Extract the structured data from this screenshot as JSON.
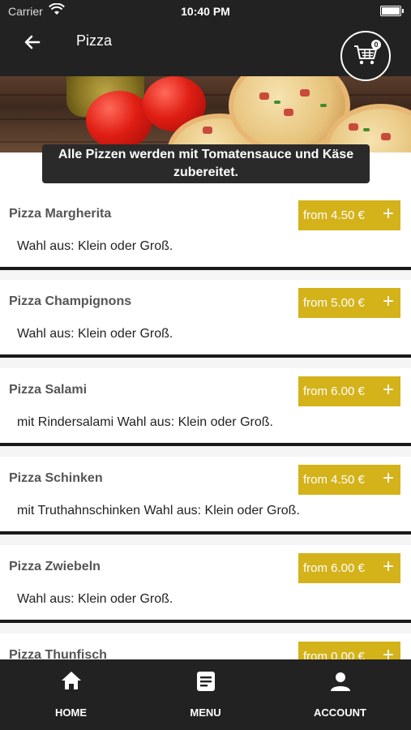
{
  "status_bar": {
    "carrier": "Carrier",
    "time": "10:40 PM"
  },
  "header": {
    "title": "Pizza",
    "back_icon": "arrow-left-icon"
  },
  "cart": {
    "count": "0",
    "icon": "shopping-cart-icon"
  },
  "notice": {
    "text": "Alle Pizzen werden mit Tomatensauce und Käse zubereitet."
  },
  "accent_color": "#d4b21a",
  "items": [
    {
      "name": "Pizza Margherita",
      "price": "from 4.50 €",
      "plus": "+",
      "description": "Wahl aus: Klein oder Groß."
    },
    {
      "name": "Pizza Champignons",
      "price": "from 5.00 €",
      "plus": "+",
      "description": "Wahl aus: Klein oder Groß."
    },
    {
      "name": "Pizza Salami",
      "price": "from 6.00 €",
      "plus": "+",
      "description": "mit Rindersalami  Wahl aus: Klein oder Groß."
    },
    {
      "name": "Pizza Schinken",
      "price": "from 4.50 €",
      "plus": "+",
      "description": "mit Truthahnschinken  Wahl aus: Klein oder Groß."
    },
    {
      "name": "Pizza Zwiebeln",
      "price": "from 6.00 €",
      "plus": "+",
      "description": "Wahl aus: Klein oder Groß."
    },
    {
      "name": "Pizza Thunfisch",
      "price": "from 0.00 €",
      "plus": "+",
      "description": ""
    }
  ],
  "tabs": [
    {
      "label": "HOME",
      "icon": "home-icon"
    },
    {
      "label": "MENU",
      "icon": "menu-icon"
    },
    {
      "label": "ACCOUNT",
      "icon": "account-icon"
    }
  ]
}
